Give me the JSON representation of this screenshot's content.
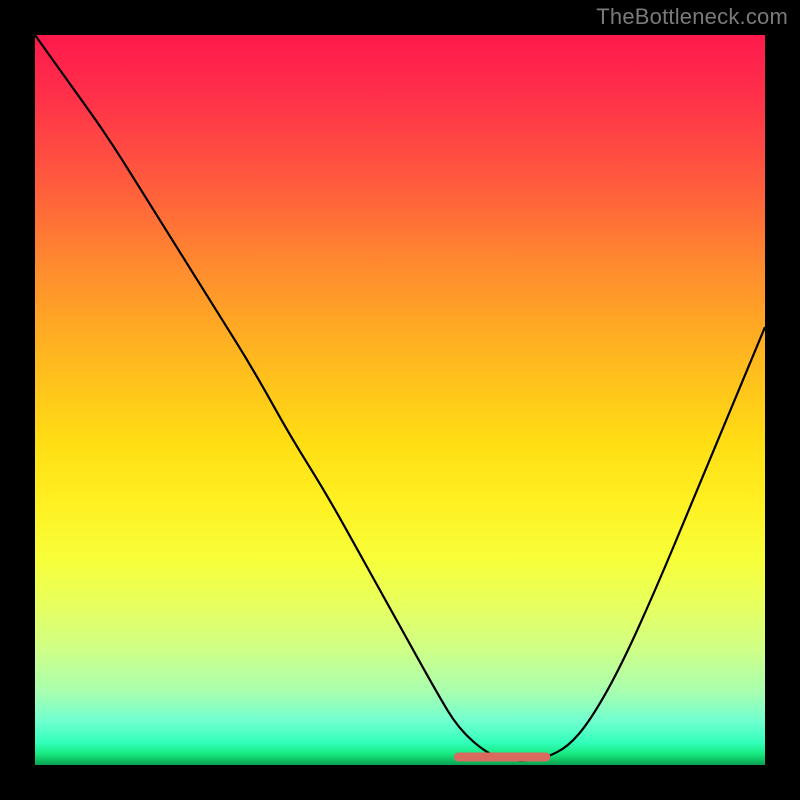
{
  "watermark": "TheBottleneck.com",
  "colors": {
    "frame": "#000000",
    "curve_stroke": "#000000",
    "flat_marker": "#d86a5f",
    "gradient_top": "#ff1a4c",
    "gradient_bottom": "#0aa050"
  },
  "chart_data": {
    "type": "line",
    "title": "",
    "xlabel": "",
    "ylabel": "",
    "xlim": [
      0,
      100
    ],
    "ylim": [
      0,
      100
    ],
    "x": [
      0,
      5,
      10,
      15,
      20,
      25,
      30,
      35,
      40,
      45,
      50,
      55,
      58,
      62,
      65,
      68,
      70,
      73,
      76,
      80,
      85,
      90,
      95,
      100
    ],
    "values": [
      100,
      93,
      86,
      78,
      70,
      62,
      54,
      45,
      37,
      28,
      19,
      10,
      5,
      1.5,
      0.6,
      0.6,
      1.0,
      2.5,
      6,
      13,
      24,
      36,
      48,
      60
    ],
    "flat_region_x": [
      58,
      70
    ],
    "note": "V-shaped bottleneck curve; y is bottleneck severity (100 = max at top of gradient, 0 = optimal at bottom). Flat optimal zone highlighted in salmon."
  }
}
